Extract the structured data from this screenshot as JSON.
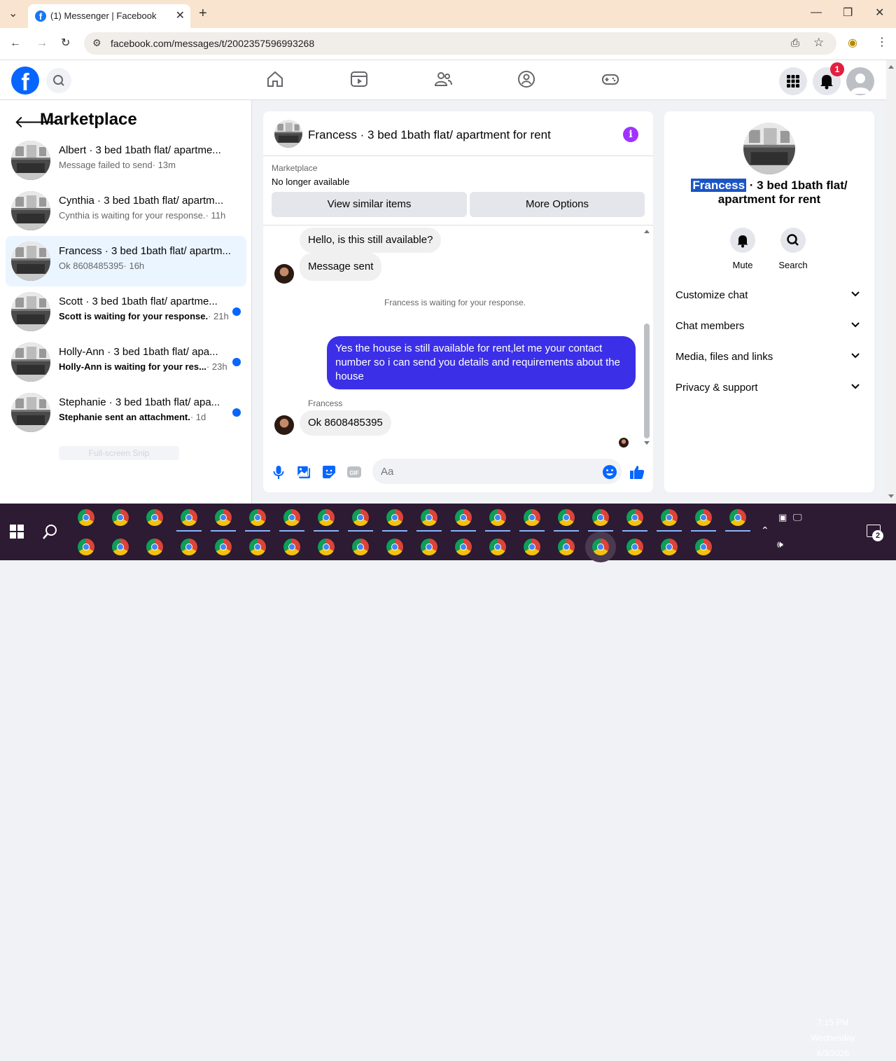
{
  "browser": {
    "tab_title": "(1) Messenger | Facebook",
    "url": "facebook.com/messages/t/2002357596993268"
  },
  "fb": {
    "notification_count": "1"
  },
  "left": {
    "heading": "Marketplace",
    "conversations": [
      {
        "name": "Albert · 3 bed 1bath flat/ apartme...",
        "preview": "Message failed to send",
        "time": "· 13m",
        "unread": false,
        "active": false
      },
      {
        "name": "Cynthia · 3 bed 1bath flat/ apartm...",
        "preview": "Cynthia is waiting for your response.",
        "time": "· 11h",
        "unread": false,
        "active": false
      },
      {
        "name": "Francess · 3 bed 1bath flat/ apartm...",
        "preview": "Ok 8608485395",
        "time": "· 16h",
        "unread": false,
        "active": true
      },
      {
        "name": "Scott · 3 bed 1bath flat/ apartme...",
        "preview": "Scott is waiting for your response.",
        "time": "· 21h",
        "unread": true,
        "active": false
      },
      {
        "name": "Holly-Ann · 3 bed 1bath flat/ apa...",
        "preview": "Holly-Ann is waiting for your res...",
        "time": "· 23h",
        "unread": true,
        "active": false
      },
      {
        "name": "Stephanie · 3 bed 1bath flat/ apa...",
        "preview": "Stephanie sent an attachment.",
        "time": "· 1d",
        "unread": true,
        "active": false
      }
    ],
    "ghost_text": "Full-screen Snip"
  },
  "chat": {
    "title": "Francess · 3 bed 1bath flat/ apartment for rent",
    "marketplace_label": "Marketplace",
    "listing_status": "No longer available",
    "view_similar": "View similar items",
    "more_options": "More Options",
    "messages": {
      "m1": "Hello, is this still available?",
      "m2": "Message sent",
      "system": "Francess is waiting for your response.",
      "m3": "Yes the house is still available for rent,let me your contact number so i can send you details and requirements about the house",
      "sender": "Francess",
      "m4": "Ok 8608485395"
    },
    "input_placeholder": "Aa"
  },
  "info": {
    "name_selected": "Francess",
    "title_rest": " · 3 bed 1bath flat/ apartment for rent",
    "mute": "Mute",
    "search": "Search",
    "sections": [
      "Customize chat",
      "Chat members",
      "Media, files and links",
      "Privacy & support"
    ]
  },
  "taskbar": {
    "time": "7:15 PM",
    "day": "Wednesday",
    "date": "6/3/2026",
    "notif_count": "2"
  }
}
